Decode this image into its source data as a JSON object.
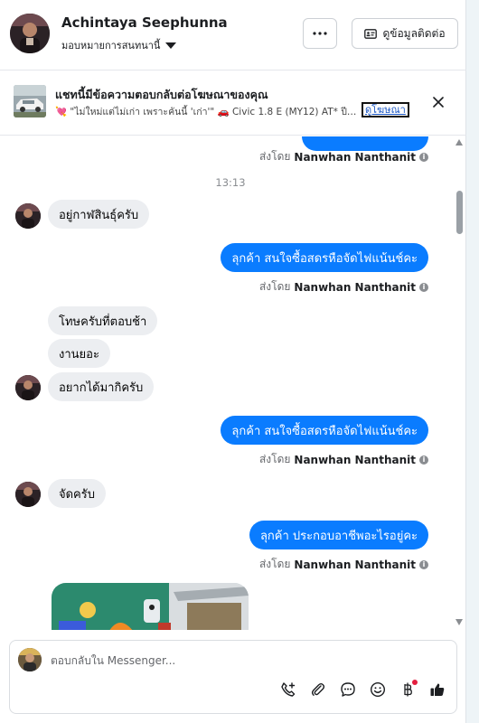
{
  "header": {
    "name": "Achintaya Seephunna",
    "assign_label": "มอบหมายการสนทนานี้",
    "more_label": "···",
    "contact_button": "ดูข้อมูลติดต่อ"
  },
  "ad": {
    "title": "แชทนี้มีข้อความตอบกลับต่อโฆษณาของคุณ",
    "description": "💘 \"ไม่ใหม่แต่ไม่เก่า เพราะคันนี้ 'เก่า'\" 🚗 Civic 1.8 E (MY12) AT* ปี 201...",
    "link": "ดูโฆษณา"
  },
  "messages": {
    "top_sent_prefix": "ส่งโดย",
    "top_sent_name": "Nanwhan Nanthanit",
    "time": "13:13",
    "in_1": "อยู่กาฬสินธุ์ครับ",
    "out_1": "ลุกค้า  สนใจซื้อสดรหือจัดไฟแน้นช์คะ",
    "sent_prefix_1": "ส่งโดย",
    "sent_name_1": "Nanwhan Nanthanit",
    "in_2": "โทษครับที่ตอบช้า",
    "in_3": "งานยอะ",
    "in_4": "อยากได้มากิครับ",
    "out_2": "ลุกค้า  สนใจซื้อสดรหือจัดไฟแน้นช์คะ",
    "sent_prefix_2": "ส่งโดย",
    "sent_name_2": "Nanwhan Nanthanit",
    "in_5": "จัดครับ",
    "out_3": "ลุกค้า ประกอบอาชีพอะไรอยู่คะ",
    "sent_prefix_3": "ส่งโดย",
    "sent_name_3": "Nanwhan Nanthanit"
  },
  "composer": {
    "placeholder": "ตอบกลับใน Messenger..."
  },
  "colors": {
    "outgoing_bubble": "#0a7cff",
    "incoming_bubble": "#eceef1",
    "link": "#1a56c4"
  },
  "icons": {
    "more": "more-horizontal-icon",
    "contact": "contact-card-icon",
    "close": "close-icon",
    "call": "call-add-icon",
    "attach": "paperclip-icon",
    "saved_reply": "chat-bubble-icon",
    "emoji": "emoji-icon",
    "payment": "baht-payment-icon",
    "like": "thumbs-up-icon"
  }
}
